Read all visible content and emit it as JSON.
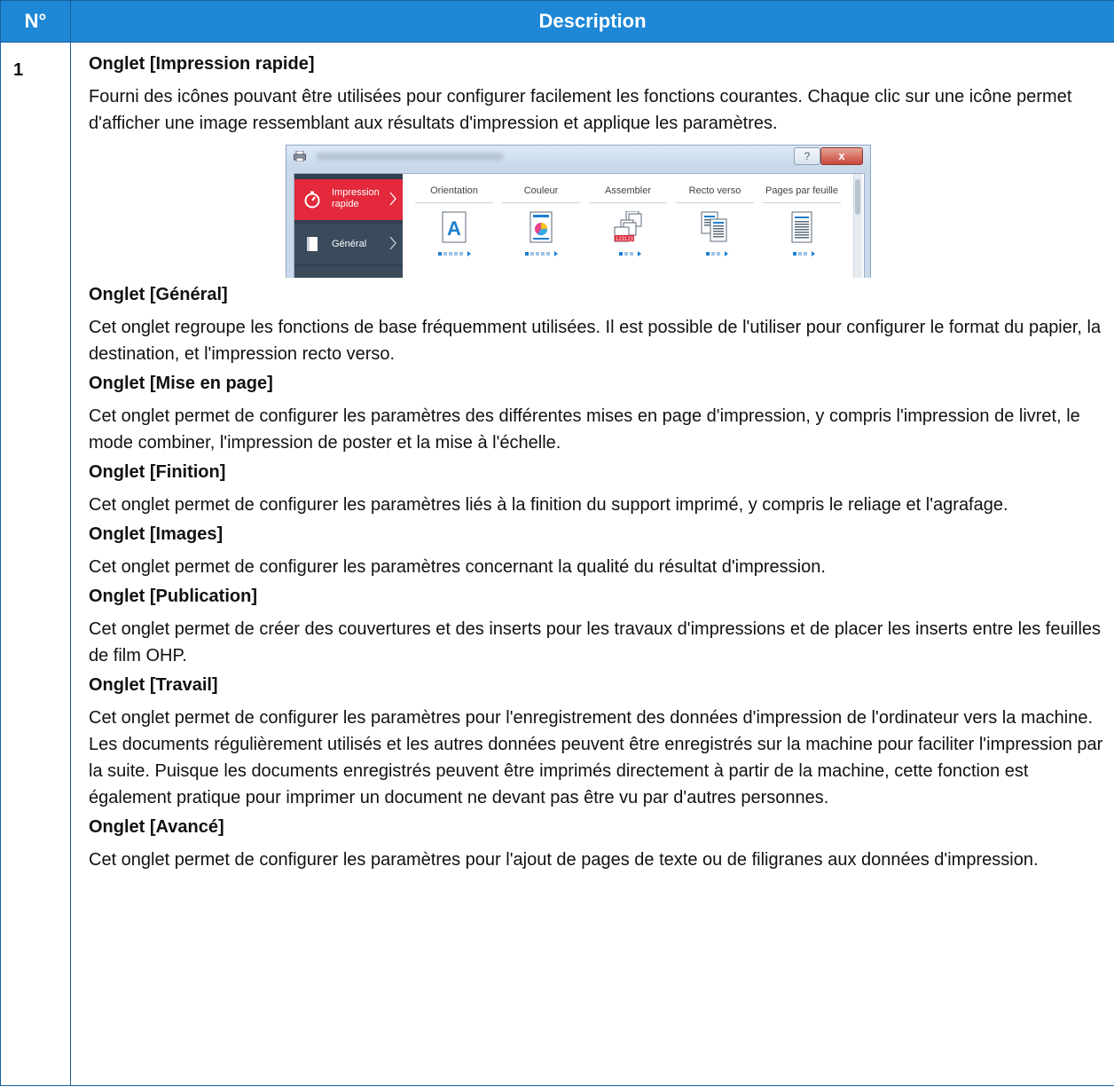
{
  "table": {
    "header": {
      "num": "N°",
      "description": "Description"
    },
    "row_number": "1",
    "intro": {
      "title": "Onglet [Impression rapide]",
      "body": "Fourni des icônes pouvant être utilisées pour configurer facilement les fonctions courantes. Chaque clic sur une icône permet d'afficher une image ressemblant aux résultats d'impression et applique les paramètres."
    },
    "sections": [
      {
        "title": "Onglet [Général]",
        "body": "Cet onglet regroupe les fonctions de base fréquemment utilisées. Il est possible de l'utiliser pour configurer le format du papier, la destination, et l'impression recto verso."
      },
      {
        "title": "Onglet [Mise en page]",
        "body": "Cet onglet permet de configurer les paramètres des différentes mises en page d'impression, y compris l'impression de livret, le mode combiner, l'impression de poster et la mise à l'échelle."
      },
      {
        "title": "Onglet [Finition]",
        "body": "Cet onglet permet de configurer les paramètres liés à la finition du support imprimé, y compris le reliage et l'agrafage."
      },
      {
        "title": "Onglet [Images]",
        "body": "Cet onglet permet de configurer les paramètres concernant la qualité du résultat d'impression."
      },
      {
        "title": "Onglet [Publication]",
        "body": "Cet onglet permet de créer des couvertures et des inserts pour les travaux d'impressions et de placer les inserts entre les feuilles de film OHP."
      },
      {
        "title": "Onglet [Travail]",
        "body": "Cet onglet permet de configurer les paramètres pour l'enregistrement des données d'impression de l'ordinateur vers la machine. Les documents régulièrement utilisés et les autres données peuvent être enregistrés sur la machine pour faciliter l'impression par la suite. Puisque les documents enregistrés peuvent être imprimés directement à partir de la machine, cette fonction est également pratique pour imprimer un document ne devant pas être vu par d'autres personnes."
      },
      {
        "title": "Onglet [Avancé]",
        "body": "Cet onglet permet de configurer les paramètres pour l'ajout de pages de texte ou de filigranes aux données d'impression."
      }
    ]
  },
  "screenshot": {
    "help_button": "?",
    "close_button": "x",
    "sidebar": [
      {
        "label": "Impression rapide",
        "icon": "stopwatch-icon"
      },
      {
        "label": "Général",
        "icon": "page-icon"
      }
    ],
    "options": [
      {
        "label": "Orientation",
        "icon": "orientation-a-icon"
      },
      {
        "label": "Couleur",
        "icon": "color-icon"
      },
      {
        "label": "Assembler",
        "icon": "collate-icon"
      },
      {
        "label": "Recto verso",
        "icon": "duplex-icon"
      },
      {
        "label": "Pages par feuille",
        "icon": "pages-per-sheet-icon"
      }
    ],
    "colors": {
      "header_bg": "#1e87d6",
      "active_tab": "#e3293b",
      "sidebar_bg": "#2f3f4f",
      "icon_blue": "#1e7fd0"
    }
  }
}
